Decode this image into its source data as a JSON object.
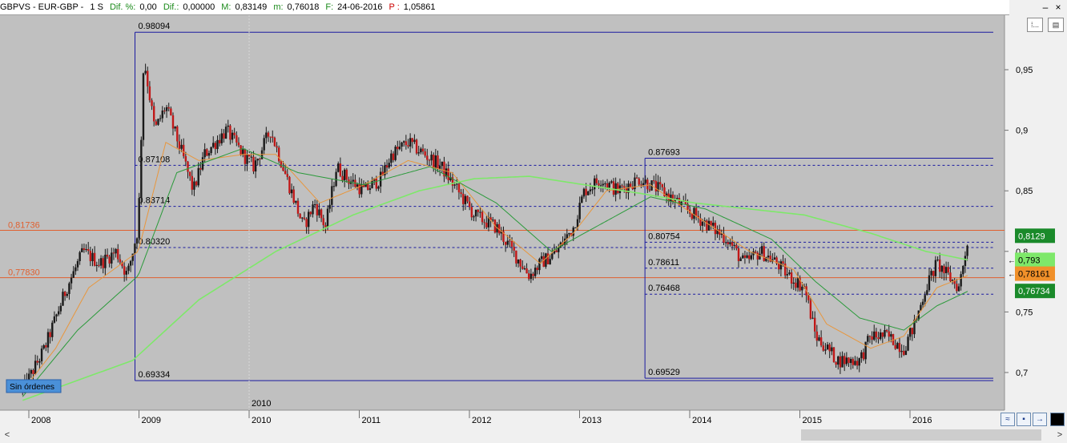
{
  "header": {
    "symbol": "GBPVS - EUR-GBP -",
    "timeframe": "1 S",
    "dif_pct_label": "Dif. %:",
    "dif_pct_value": "0,00",
    "dif_label": "Dif.:",
    "dif_value": "0,00000",
    "max_label": "M:",
    "max_value": "0,83149",
    "min_label": "m:",
    "min_value": "0,76018",
    "date_label": "F:",
    "date_value": "24-06-2016",
    "p_label": "P :",
    "p_value": "1,05861"
  },
  "toolbar": {
    "minimize": "–",
    "close": "×",
    "btn1": "⁞...",
    "btn2": "▤"
  },
  "scroll": {
    "left": "<",
    "right": ">"
  },
  "bottom_tools": {
    "wave": "≈",
    "save": "▪",
    "export": "→",
    "black": "■"
  },
  "chart_data": {
    "type": "candlestick",
    "instrument": "GBPVS - EUR-GBP",
    "x_tick_labels": [
      "2008",
      "2009",
      "2010",
      "2011",
      "2012",
      "2013",
      "2014",
      "2015",
      "2016"
    ],
    "y_tick_labels": [
      "0,95",
      "0,9",
      "0,85",
      "0,8",
      "0,75",
      "0,7"
    ],
    "ylim": [
      0.68,
      0.985
    ],
    "top_marker_label": "2010",
    "order_label": "Sin órdenes",
    "horizontal_levels": [
      {
        "label": "0,81736",
        "value": 0.81736,
        "color": "#e06030"
      },
      {
        "label": "0,77830",
        "value": 0.7783,
        "color": "#e06030"
      }
    ],
    "fibonacci": [
      {
        "from": "2008-12",
        "to_right_edge": true,
        "levels": [
          {
            "label": "0.98094",
            "value": 0.98094,
            "style": "solid"
          },
          {
            "label": "0.87108",
            "value": 0.87108,
            "style": "dashed"
          },
          {
            "label": "0.83714",
            "value": 0.83714,
            "style": "dashed"
          },
          {
            "label": "0.80320",
            "value": 0.8032,
            "style": "dashed"
          },
          {
            "label": "0.69334",
            "value": 0.69334,
            "style": "solid"
          }
        ]
      },
      {
        "from": "2013-07",
        "to_right_edge": true,
        "levels": [
          {
            "label": "0.87693",
            "value": 0.87693,
            "style": "solid"
          },
          {
            "label": "0.80754",
            "value": 0.80754,
            "style": "dashed"
          },
          {
            "label": "0.78611",
            "value": 0.78611,
            "style": "dashed"
          },
          {
            "label": "0.76468",
            "value": 0.76468,
            "style": "dashed"
          },
          {
            "label": "0.69529",
            "value": 0.69529,
            "style": "solid"
          }
        ]
      }
    ],
    "price_badges": [
      {
        "label": "0,8129",
        "value": 0.8129,
        "color": "#1a8a2a",
        "text_color": "#ffffff"
      },
      {
        "label": "0,793",
        "value": 0.793,
        "color": "#7ee86a",
        "text_color": "#000000"
      },
      {
        "label": "0,78161",
        "value": 0.78161,
        "color": "#f0902a",
        "text_color": "#000000"
      },
      {
        "label": "0,76734",
        "value": 0.76734,
        "color": "#1a8a2a",
        "text_color": "#ffffff"
      }
    ],
    "series": [
      {
        "kind": "weekly candles",
        "color_up": "#1a1a1a",
        "color_down": "#c01818",
        "anchors": [
          [
            2007.9,
            0.685
          ],
          [
            2008.1,
            0.72
          ],
          [
            2008.3,
            0.77
          ],
          [
            2008.45,
            0.8
          ],
          [
            2008.6,
            0.79
          ],
          [
            2008.75,
            0.8
          ],
          [
            2008.85,
            0.78
          ],
          [
            2008.95,
            0.82
          ],
          [
            2009.0,
            0.96
          ],
          [
            2009.1,
            0.9
          ],
          [
            2009.2,
            0.92
          ],
          [
            2009.35,
            0.88
          ],
          [
            2009.45,
            0.85
          ],
          [
            2009.55,
            0.88
          ],
          [
            2009.65,
            0.89
          ],
          [
            2009.75,
            0.9
          ],
          [
            2009.9,
            0.88
          ],
          [
            2010.0,
            0.87
          ],
          [
            2010.15,
            0.9
          ],
          [
            2010.3,
            0.86
          ],
          [
            2010.45,
            0.82
          ],
          [
            2010.55,
            0.84
          ],
          [
            2010.65,
            0.82
          ],
          [
            2010.75,
            0.87
          ],
          [
            2010.85,
            0.86
          ],
          [
            2011.0,
            0.85
          ],
          [
            2011.15,
            0.86
          ],
          [
            2011.25,
            0.88
          ],
          [
            2011.4,
            0.89
          ],
          [
            2011.55,
            0.88
          ],
          [
            2011.7,
            0.87
          ],
          [
            2011.85,
            0.85
          ],
          [
            2012.0,
            0.83
          ],
          [
            2012.2,
            0.82
          ],
          [
            2012.35,
            0.8
          ],
          [
            2012.5,
            0.78
          ],
          [
            2012.6,
            0.79
          ],
          [
            2012.75,
            0.8
          ],
          [
            2012.9,
            0.82
          ],
          [
            2013.0,
            0.85
          ],
          [
            2013.15,
            0.86
          ],
          [
            2013.3,
            0.85
          ],
          [
            2013.5,
            0.86
          ],
          [
            2013.7,
            0.85
          ],
          [
            2013.85,
            0.84
          ],
          [
            2014.0,
            0.83
          ],
          [
            2014.15,
            0.82
          ],
          [
            2014.3,
            0.81
          ],
          [
            2014.45,
            0.79
          ],
          [
            2014.6,
            0.8
          ],
          [
            2014.75,
            0.79
          ],
          [
            2014.85,
            0.78
          ],
          [
            2015.0,
            0.77
          ],
          [
            2015.1,
            0.73
          ],
          [
            2015.3,
            0.71
          ],
          [
            2015.5,
            0.71
          ],
          [
            2015.6,
            0.73
          ],
          [
            2015.75,
            0.73
          ],
          [
            2015.9,
            0.72
          ],
          [
            2016.0,
            0.74
          ],
          [
            2016.1,
            0.77
          ],
          [
            2016.2,
            0.79
          ],
          [
            2016.3,
            0.78
          ],
          [
            2016.4,
            0.77
          ],
          [
            2016.48,
            0.81
          ]
        ]
      },
      {
        "kind": "moving average short",
        "color": "#e8963c",
        "anchors": [
          [
            2007.9,
            0.685
          ],
          [
            2008.2,
            0.72
          ],
          [
            2008.5,
            0.77
          ],
          [
            2008.95,
            0.8
          ],
          [
            2009.2,
            0.89
          ],
          [
            2009.5,
            0.875
          ],
          [
            2009.9,
            0.88
          ],
          [
            2010.2,
            0.88
          ],
          [
            2010.6,
            0.84
          ],
          [
            2011.0,
            0.855
          ],
          [
            2011.4,
            0.875
          ],
          [
            2011.8,
            0.865
          ],
          [
            2012.2,
            0.82
          ],
          [
            2012.6,
            0.79
          ],
          [
            2012.9,
            0.815
          ],
          [
            2013.2,
            0.85
          ],
          [
            2013.6,
            0.855
          ],
          [
            2014.0,
            0.83
          ],
          [
            2014.5,
            0.8
          ],
          [
            2014.9,
            0.785
          ],
          [
            2015.2,
            0.74
          ],
          [
            2015.6,
            0.72
          ],
          [
            2015.9,
            0.73
          ],
          [
            2016.2,
            0.77
          ],
          [
            2016.48,
            0.78
          ]
        ]
      },
      {
        "kind": "moving average medium",
        "color": "#2a9a3a",
        "anchors": [
          [
            2007.9,
            0.68
          ],
          [
            2008.4,
            0.735
          ],
          [
            2008.95,
            0.78
          ],
          [
            2009.3,
            0.865
          ],
          [
            2009.9,
            0.885
          ],
          [
            2010.4,
            0.865
          ],
          [
            2011.0,
            0.855
          ],
          [
            2011.6,
            0.87
          ],
          [
            2012.2,
            0.84
          ],
          [
            2012.7,
            0.8
          ],
          [
            2013.1,
            0.82
          ],
          [
            2013.6,
            0.845
          ],
          [
            2014.1,
            0.835
          ],
          [
            2014.7,
            0.81
          ],
          [
            2015.1,
            0.775
          ],
          [
            2015.5,
            0.745
          ],
          [
            2015.9,
            0.735
          ],
          [
            2016.2,
            0.755
          ],
          [
            2016.48,
            0.767
          ]
        ]
      },
      {
        "kind": "moving average long",
        "color": "#7ee86a",
        "anchors": [
          [
            2007.9,
            0.677
          ],
          [
            2008.9,
            0.71
          ],
          [
            2009.5,
            0.76
          ],
          [
            2010.2,
            0.8
          ],
          [
            2010.9,
            0.83
          ],
          [
            2011.5,
            0.85
          ],
          [
            2012.0,
            0.86
          ],
          [
            2012.5,
            0.862
          ],
          [
            2013.0,
            0.855
          ],
          [
            2013.5,
            0.848
          ],
          [
            2014.0,
            0.84
          ],
          [
            2014.5,
            0.835
          ],
          [
            2015.0,
            0.83
          ],
          [
            2015.6,
            0.815
          ],
          [
            2016.1,
            0.8
          ],
          [
            2016.48,
            0.793
          ]
        ]
      }
    ]
  }
}
